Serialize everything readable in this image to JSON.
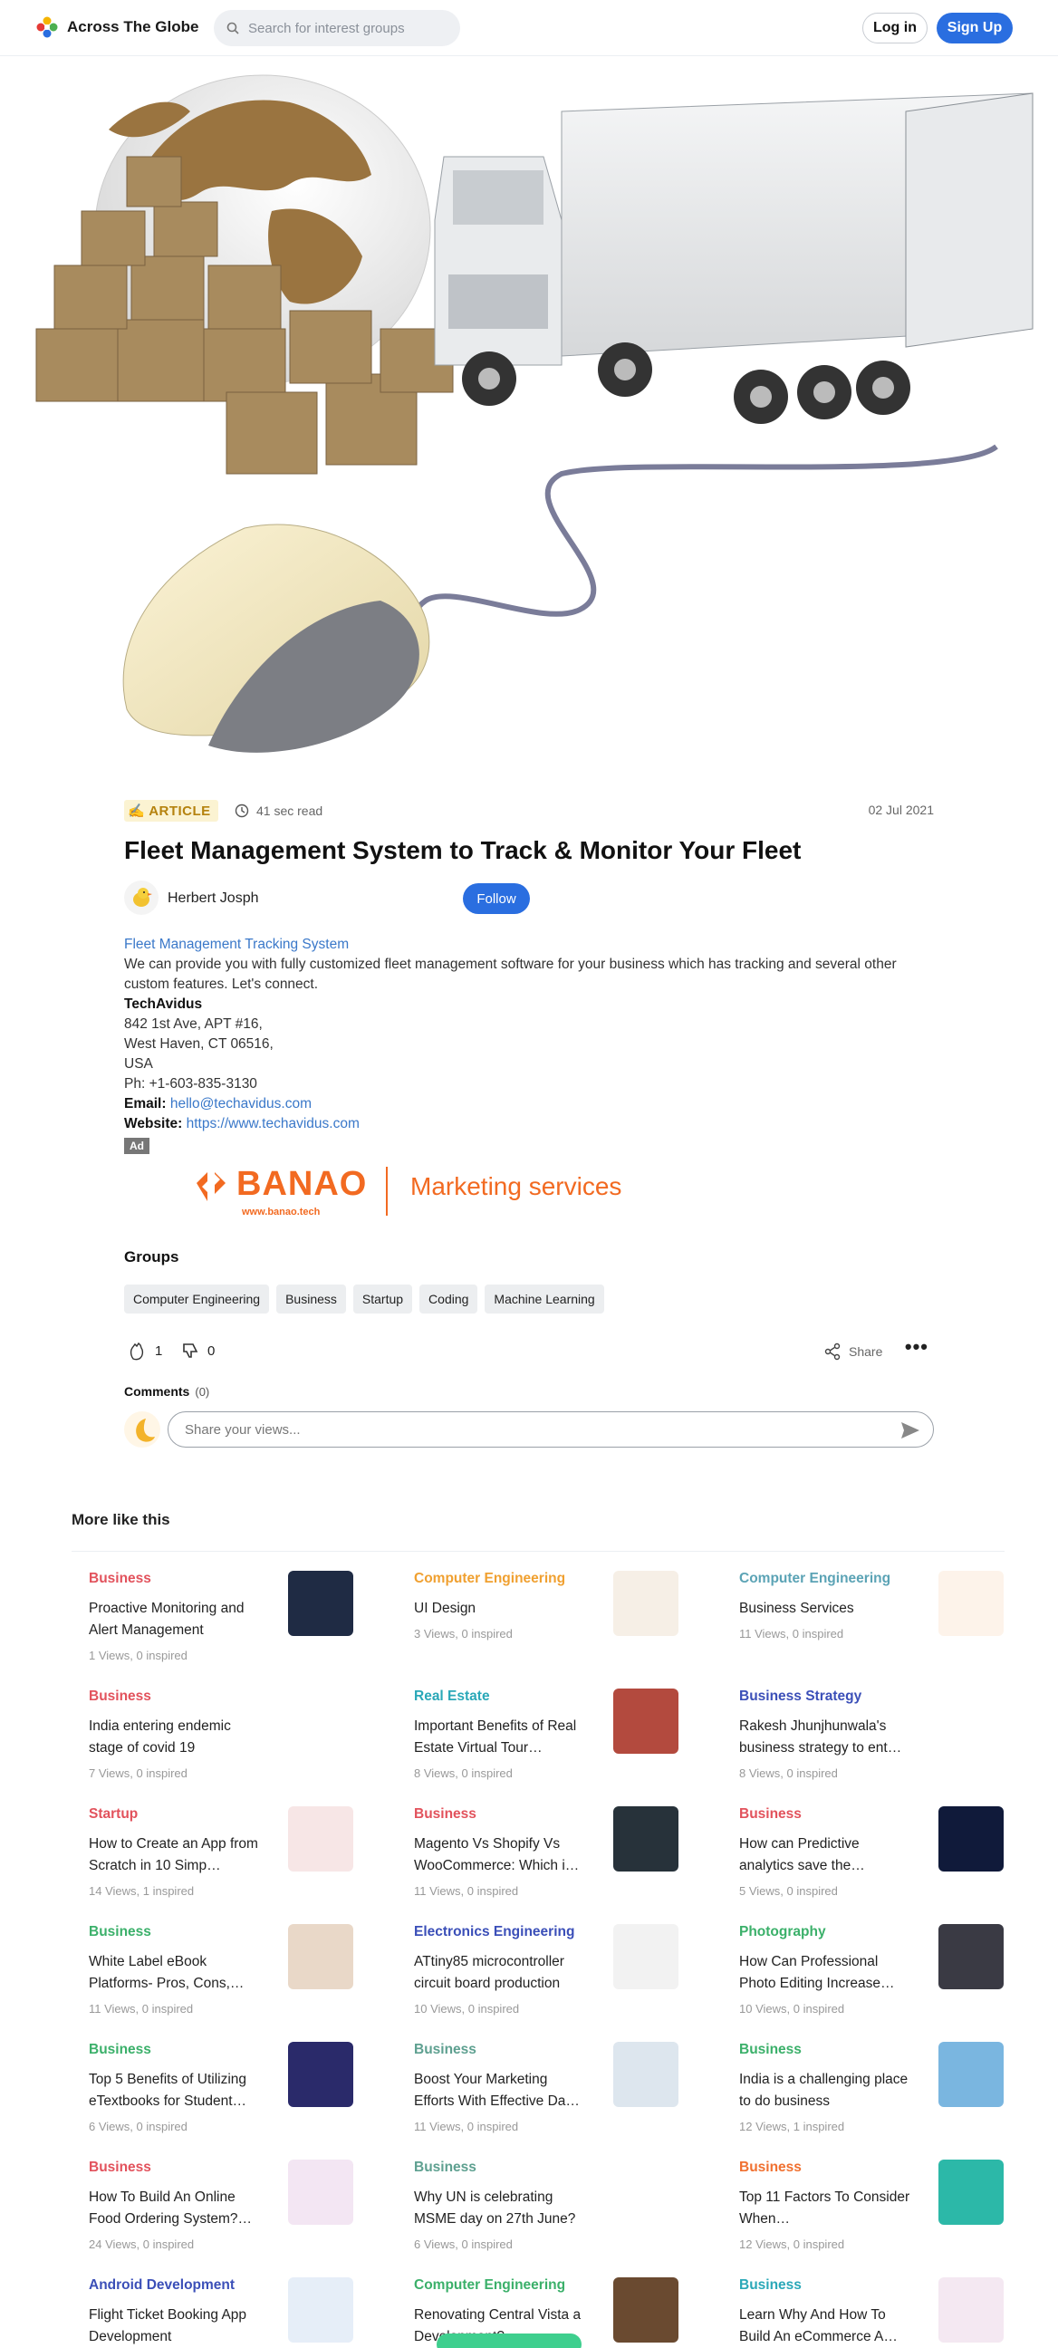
{
  "header": {
    "brand": "Across The Globe",
    "search_placeholder": "Search for interest groups",
    "login_label": "Log in",
    "signup_label": "Sign Up"
  },
  "article": {
    "badge": "ARTICLE",
    "read_time": "41 sec read",
    "date": "02 Jul 2021",
    "title": "Fleet Management System to Track & Monitor Your Fleet",
    "author": "Herbert Josph",
    "follow_label": "Follow",
    "link_text": "Fleet Management Tracking System",
    "paragraph": "We can provide you with fully customized fleet management software for your business which has tracking and several other custom features. Let's connect.",
    "company": "TechAvidus",
    "address1": "842 1st Ave, APT #16,",
    "address2": "West Haven, CT 06516,",
    "address3": "USA",
    "phone": "Ph: +1-603-835-3130",
    "email_label": "Email:",
    "email": "hello@techavidus.com",
    "website_label": "Website:",
    "website": "https://www.techavidus.com"
  },
  "ad": {
    "tag": "Ad",
    "brand": "BANAO",
    "brand_url": "www.banao.tech",
    "tagline": "Marketing services",
    "color": "#f26a21"
  },
  "groups": {
    "title": "Groups",
    "items": [
      "Computer Engineering",
      "Business",
      "Startup",
      "Coding",
      "Machine Learning"
    ]
  },
  "reactions": {
    "likes": "1",
    "dislikes": "0",
    "share_label": "Share",
    "more_label": "•••"
  },
  "comments": {
    "title": "Comments",
    "count": "(0)",
    "placeholder": "Share your views..."
  },
  "more_like": {
    "title": "More like this",
    "cards": [
      {
        "category": "Business",
        "color": "#e2525c",
        "title": "Proactive Monitoring and Alert Management",
        "stats": "1 Views, 0 inspired",
        "thumb": "#1f2b44"
      },
      {
        "category": "Computer Engineering",
        "color": "#f0a030",
        "title": "UI Design",
        "stats": "3 Views, 0 inspired",
        "thumb": "#f6efe6"
      },
      {
        "category": "Computer Engineering",
        "color": "#5ba3b5",
        "title": "Business Services",
        "stats": "11 Views, 0 inspired",
        "thumb": "#fdf3ea"
      },
      {
        "category": "Business",
        "color": "#e2525c",
        "title": "India entering endemic stage of covid 19",
        "stats": "7 Views, 0 inspired",
        "thumb": ""
      },
      {
        "category": "Real Estate",
        "color": "#2aa8b8",
        "title": "Important Benefits of Real Estate Virtual Tour…",
        "stats": "8 Views, 0 inspired",
        "thumb": "#b34a3e"
      },
      {
        "category": "Business Strategy",
        "color": "#3b4fb8",
        "title": "Rakesh Jhunjhunwala's business strategy to ent…",
        "stats": "8 Views, 0 inspired",
        "thumb": ""
      },
      {
        "category": "Startup",
        "color": "#e2525c",
        "title": "How to Create an App from Scratch in 10 Simp…",
        "stats": "14 Views, 1 inspired",
        "thumb": "#f7e6e6"
      },
      {
        "category": "Business",
        "color": "#e2525c",
        "title": "Magento Vs Shopify Vs WooCommerce: Which i…",
        "stats": "11 Views, 0 inspired",
        "thumb": "#27323a"
      },
      {
        "category": "Business",
        "color": "#e2525c",
        "title": "How can Predictive analytics save the…",
        "stats": "5 Views, 0 inspired",
        "thumb": "#101a3a"
      },
      {
        "category": "Business",
        "color": "#3bb06a",
        "title": "White Label eBook Platforms- Pros, Cons,…",
        "stats": "11 Views, 0 inspired",
        "thumb": "#e9d8c8"
      },
      {
        "category": "Electronics Engineering",
        "color": "#3b4fb8",
        "title": "ATtiny85 microcontroller circuit board production",
        "stats": "10 Views, 0 inspired",
        "thumb": "#f2f2f2"
      },
      {
        "category": "Photography",
        "color": "#3bb06a",
        "title": "How Can Professional Photo Editing Increase…",
        "stats": "10 Views, 0 inspired",
        "thumb": "#3a3a44"
      },
      {
        "category": "Business",
        "color": "#3bb06a",
        "title": "Top 5 Benefits of Utilizing eTextbooks for Student…",
        "stats": "6 Views, 0 inspired",
        "thumb": "#2a2a6a"
      },
      {
        "category": "Business",
        "color": "#5ea090",
        "title": "Boost Your Marketing Efforts With Effective Da…",
        "stats": "11 Views, 0 inspired",
        "thumb": "#dde6ee"
      },
      {
        "category": "Business",
        "color": "#3bb06a",
        "title": "India is a challenging place to do business",
        "stats": "12 Views, 1 inspired",
        "thumb": "#7ab6e0"
      },
      {
        "category": "Business",
        "color": "#e2525c",
        "title": "How To Build An Online Food Ordering System?…",
        "stats": "24 Views, 0 inspired",
        "thumb": "#f3e6f3"
      },
      {
        "category": "Business",
        "color": "#5ea090",
        "title": "Why UN is celebrating MSME day on 27th June?",
        "stats": "6 Views, 0 inspired",
        "thumb": ""
      },
      {
        "category": "Business",
        "color": "#f07030",
        "title": "Top 11 Factors To Consider When…",
        "stats": "12 Views, 0 inspired",
        "thumb": "#2cb8a8"
      },
      {
        "category": "Android Development",
        "color": "#3b4fb8",
        "title": "Flight Ticket Booking App Development",
        "stats": "",
        "thumb": "#e6eef8"
      },
      {
        "category": "Computer Engineering",
        "color": "#3bb06a",
        "title": "Renovating Central Vista a Development?",
        "stats": "",
        "thumb": "#6a4a30"
      },
      {
        "category": "Business",
        "color": "#2aa8b8",
        "title": "Learn Why And How To Build An eCommerce A…",
        "stats": "",
        "thumb": "#f4e8f2"
      }
    ]
  }
}
